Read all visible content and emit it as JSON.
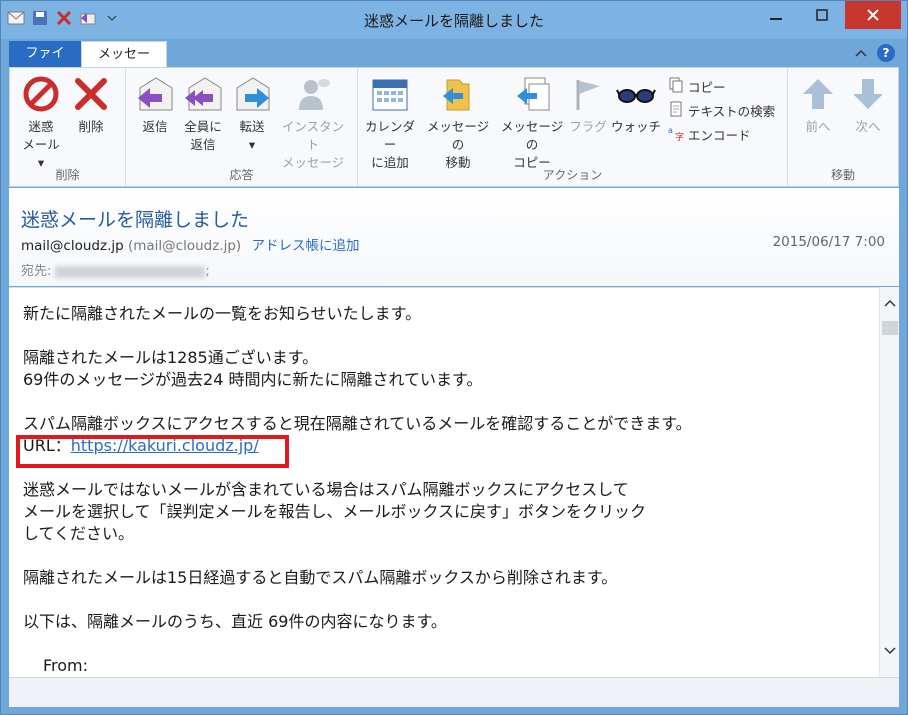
{
  "window": {
    "title": "迷惑メールを隔離しました"
  },
  "tabs": {
    "file": "ファイル",
    "message": "メッセージ"
  },
  "ribbon": {
    "groups": {
      "delete": "削除",
      "respond": "応答",
      "actions": "アクション",
      "move": "移動"
    },
    "junk_l1": "迷惑",
    "junk_l2": "メール",
    "delete": "削除",
    "reply": "返信",
    "reply_all_l1": "全員に",
    "reply_all_l2": "返信",
    "forward": "転送",
    "im_l1": "インスタント",
    "im_l2": "メッセージ",
    "calendar_l1": "カレンダー",
    "calendar_l2": "に追加",
    "move_l1": "メッセージの",
    "move_l2": "移動",
    "copy_l1": "メッセージの",
    "copy_l2": "コピー",
    "flag": "フラグ",
    "watch": "ウォッチ",
    "copy": "コピー",
    "find": "テキストの検索",
    "encoding": "エンコード",
    "prev": "前へ",
    "next": "次へ"
  },
  "header": {
    "subject": "迷惑メールを隔離しました",
    "from_name": "mail@cloudz.jp",
    "from_addr": "(mail@cloudz.jp)",
    "add_to_contacts": "アドレス帳に追加",
    "date": "2015/06/17 7:00",
    "to_label": "宛先:",
    "to_suffix": ";"
  },
  "body": {
    "l1": "新たに隔離されたメールの一覧をお知らせいたします。",
    "l2": "隔離されたメールは1285通ございます。",
    "l3": "69件のメッセージが過去24 時間内に新たに隔離されています。",
    "l4": "スパム隔離ボックスにアクセスすると現在隔離されているメールを確認することができます。",
    "url_label": "URL：",
    "url": "https://kakuri.cloudz.jp/",
    "l5": "迷惑メールではないメールが含まれている場合はスパム隔離ボックスにアクセスして",
    "l6": "メールを選択して「誤判定メールを報告し、メールボックスに戻す」ボタンをクリック",
    "l7": "してください。",
    "l8": "隔離されたメールは15日経過すると自動でスパム隔離ボックスから削除されます。",
    "l9": "以下は、隔離メールのうち、直近 69件の内容になります。",
    "l10": "From:"
  }
}
